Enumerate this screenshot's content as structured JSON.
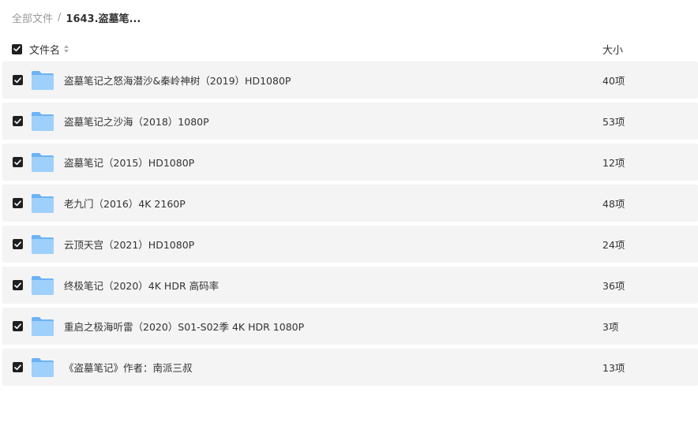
{
  "breadcrumb": {
    "root": "全部文件",
    "separator": "/",
    "current": "1643.盗墓笔..."
  },
  "table": {
    "header": {
      "name": "文件名",
      "size": "大小"
    },
    "rows": [
      {
        "name": "盗墓笔记之怒海潜沙&秦岭神树（2019）HD1080P",
        "size": "40项"
      },
      {
        "name": "盗墓笔记之沙海（2018）1080P",
        "size": "53项"
      },
      {
        "name": "盗墓笔记（2015）HD1080P",
        "size": "12项"
      },
      {
        "name": "老九门（2016）4K 2160P",
        "size": "48项"
      },
      {
        "name": "云顶天宫（2021）HD1080P",
        "size": "24项"
      },
      {
        "name": "终极笔记（2020）4K HDR 高码率",
        "size": "36项"
      },
      {
        "name": "重启之极海听雷（2020）S01-S02季 4K HDR 1080P",
        "size": "3项"
      },
      {
        "name": "《盗墓笔记》作者：南派三叔",
        "size": "13项"
      }
    ]
  },
  "icons": {
    "folder": "folder-icon",
    "checkbox": "checkbox-checked-icon",
    "sort": "sort-icon"
  },
  "colors": {
    "row_background": "#f4f4f5",
    "checkbox": "#1f1f1f",
    "folder_light": "#9fd0fb",
    "folder_dark": "#6cb3f4"
  }
}
